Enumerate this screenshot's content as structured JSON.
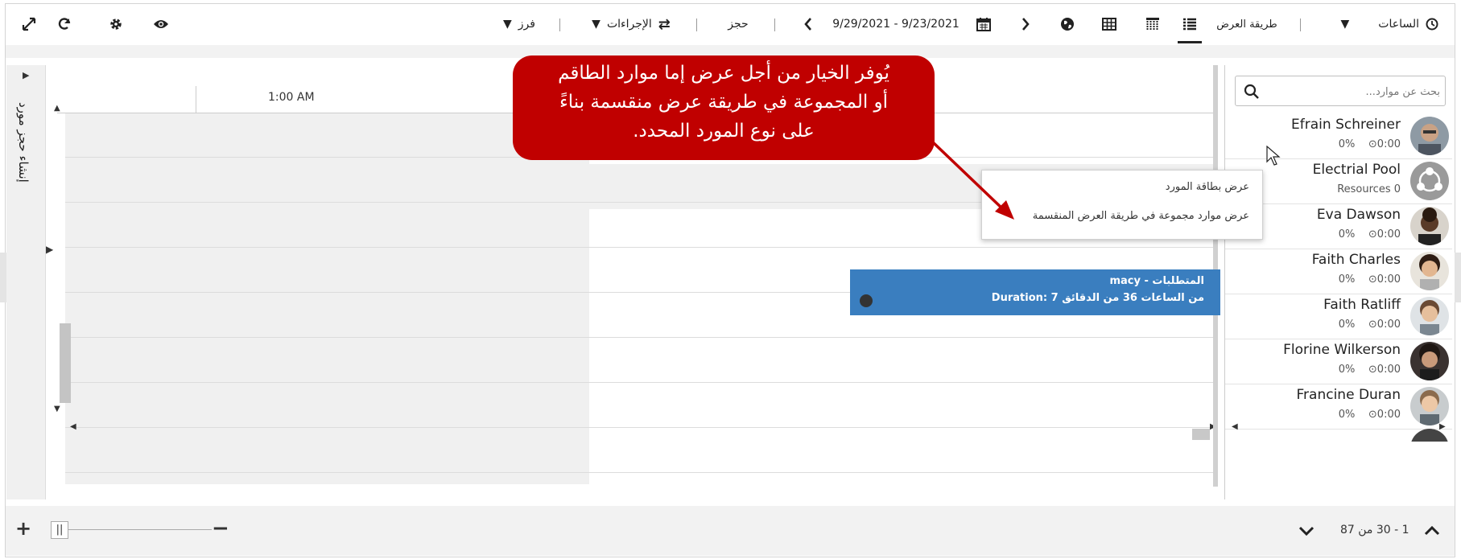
{
  "toolbar": {
    "hours_label": "الساعات",
    "view_mode_label": "طريقة العرض",
    "date_range": "9/29/2021 - 9/23/2021",
    "book_label": "حجز",
    "actions_label": "الإجراءات",
    "sort_label": "فرز"
  },
  "left_panel": {
    "create_booking_label": "إنشاء حجز مورد"
  },
  "schedule": {
    "time_header": "1:00 AM",
    "booking": {
      "title": "macy - المتطلبات",
      "duration": "Duration: 7 من الساعات 36 من الدقائق",
      "color": "#3a7ebf"
    }
  },
  "callout": {
    "line1": "يُوفر الخيار من أجل عرض إما موارد الطاقم",
    "line2": "أو المجموعة في طريقة عرض منقسمة بناءً",
    "line3": "على نوع المورد المحدد.",
    "color": "#c00000"
  },
  "context_menu": {
    "item1": "عرض بطاقة المورد",
    "item2": "عرض موارد مجموعة في طريقة العرض المنقسمة"
  },
  "resources": {
    "search_placeholder": "بحث عن موارد...",
    "items": [
      {
        "name": "Efrain Schreiner",
        "util": "0%",
        "hours": "0:00"
      },
      {
        "name": "Electrial Pool",
        "count": "Resources 0"
      },
      {
        "name": "Eva Dawson",
        "util": "0%",
        "hours": "0:00"
      },
      {
        "name": "Faith Charles",
        "util": "0%",
        "hours": "0:00"
      },
      {
        "name": "Faith Ratliff",
        "util": "0%",
        "hours": "0:00"
      },
      {
        "name": "Florine Wilkerson",
        "util": "0%",
        "hours": "0:00"
      },
      {
        "name": "Francine Duran",
        "util": "0%",
        "hours": "0:00"
      }
    ]
  },
  "pagination": {
    "text": "1 - 30 من 87"
  }
}
